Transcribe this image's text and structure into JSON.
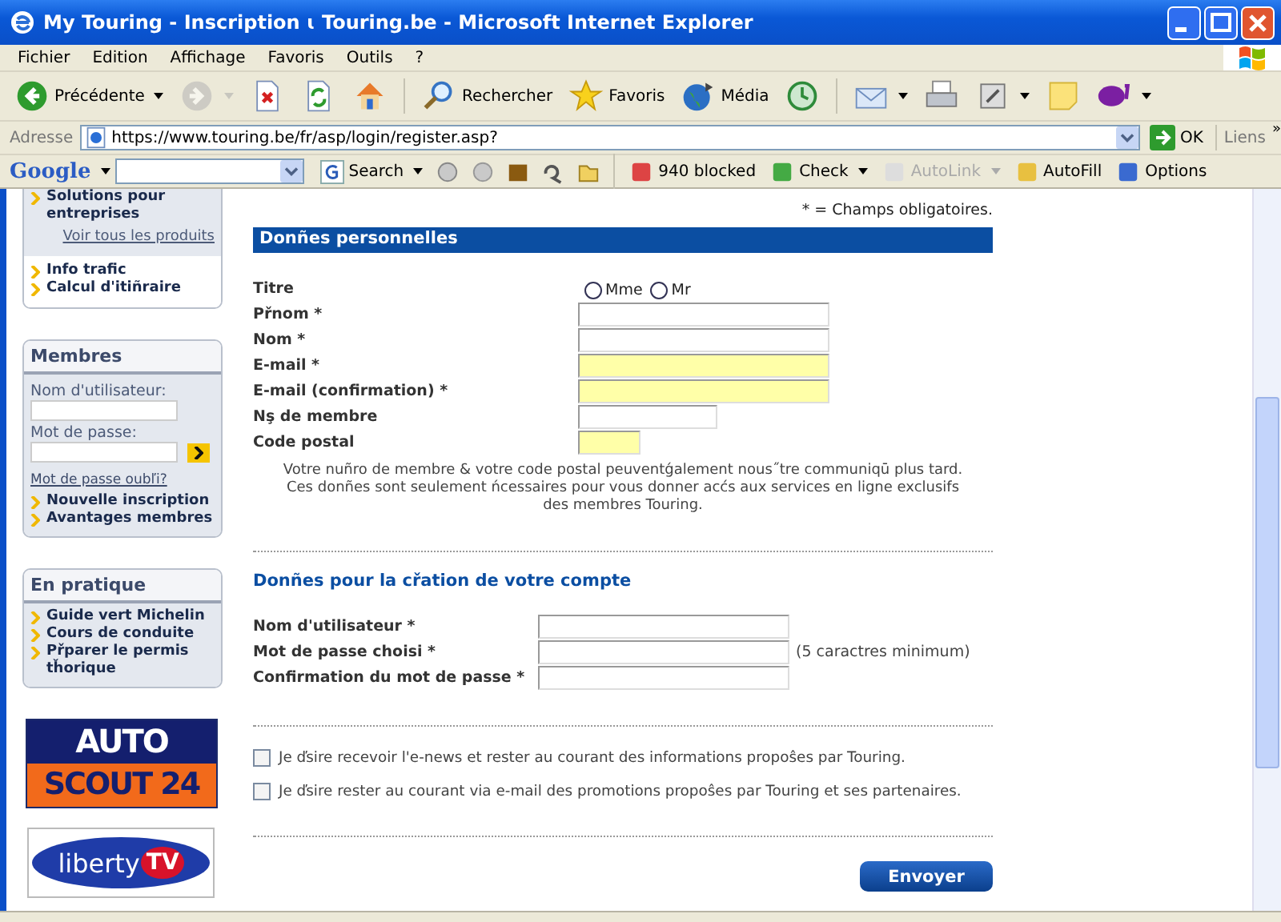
{
  "window": {
    "title": "My Touring - Inscription ɩ Touring.be - Microsoft Internet Explorer"
  },
  "menu": [
    "Fichier",
    "Edition",
    "Affichage",
    "Favoris",
    "Outils",
    "?"
  ],
  "toolbar": [
    {
      "label": "Précédente",
      "dropdown": true,
      "disabled": false
    },
    {
      "dropdown": true,
      "disabled": true
    },
    {
      "dropdown": false,
      "disabled": false
    },
    {
      "dropdown": false,
      "disabled": false
    },
    {
      "dropdown": false,
      "disabled": false
    },
    {
      "label": "Rechercher",
      "dropdown": false,
      "disabled": false,
      "separator_before": true
    },
    {
      "label": "Favoris",
      "dropdown": false,
      "disabled": false
    },
    {
      "label": "Média",
      "dropdown": false,
      "disabled": false
    },
    {
      "dropdown": false,
      "disabled": false
    },
    {
      "dropdown": true,
      "disabled": false,
      "separator_before": true
    },
    {
      "dropdown": false,
      "disabled": false
    },
    {
      "dropdown": true,
      "disabled": false
    },
    {
      "dropdown": false,
      "disabled": false
    },
    {
      "dropdown": true,
      "disabled": false
    }
  ],
  "address": {
    "label": "Adresse",
    "url": "https://www.touring.be/fr/asp/login/register.asp?",
    "go": "OK",
    "links": "Liens",
    "more": "»"
  },
  "google_bar": {
    "logo": "Google",
    "search": "Search",
    "items": [
      {
        "label": "940 blocked",
        "dropdown": false,
        "disabled": false
      },
      {
        "label": "Check",
        "dropdown": true,
        "disabled": false
      },
      {
        "label": "AutoLink",
        "dropdown": true,
        "disabled": true
      },
      {
        "label": "AutoFill",
        "dropdown": false,
        "disabled": false
      },
      {
        "label": "Options",
        "dropdown": false,
        "disabled": false
      }
    ]
  },
  "sidebar": {
    "products": {
      "items": [
        "Solutions pour entreprises"
      ],
      "all_link": "Voir tous les produits",
      "tools": [
        "Info trafic",
        "Calcul d'itiñraire"
      ]
    },
    "members": {
      "title": "Membres",
      "username_label": "Nom d'utilisateur:",
      "password_label": "Mot de passe:",
      "forgot": "Mot de passe oubľi?",
      "links": [
        "Nouvelle inscription",
        "Avantages membres"
      ]
    },
    "practical": {
      "title": "En pratique",
      "links": [
        "Guide vert Michelin",
        "Cours de conduite",
        "Přparer le permis tȟorique"
      ]
    },
    "banners": [
      {
        "kind": "autoscout",
        "lines": [
          "AUTO",
          "SCOUT 24"
        ]
      },
      {
        "kind": "liberty",
        "parts": [
          "liberty",
          "TV"
        ]
      }
    ]
  },
  "form": {
    "required_note": "* =  Champs obligatoires.",
    "personal": {
      "title": "Donñes personnelles",
      "fields": [
        {
          "kind": "radio",
          "label": "Titre",
          "options": [
            {
              "label": "Mme",
              "selected": false
            },
            {
              "label": "Mr",
              "selected": false
            }
          ]
        },
        {
          "kind": "longfield",
          "label": "Přnom *",
          "highlighted": false
        },
        {
          "kind": "longfield",
          "label": "Nom *",
          "highlighted": false
        },
        {
          "kind": "longfield",
          "label": "E-mail *",
          "highlighted": true
        },
        {
          "kind": "longfield",
          "label": "E-mail (confirmation) *",
          "highlighted": true
        },
        {
          "kind": "midfield",
          "label": "Nş de membre",
          "highlighted": false
        },
        {
          "kind": "shortfield",
          "label": "Code postal",
          "highlighted": true
        }
      ]
    },
    "note": "Votre nuñro de membre & votre code postal peuventǵalement nous˝tre communiqū plus tard. Ces donñes sont seulement ńcessaires pour vous donner acćs aux services en ligne exclusifs des membres Touring.",
    "account": {
      "title": "Donñes pour la cřation de votre compte",
      "fields": [
        {
          "label": "Nom d'utilisateur *"
        },
        {
          "label": "Mot de passe choisi *",
          "hint": "(5 caractres minimum)"
        },
        {
          "label": "Confirmation du mot de passe *"
        }
      ]
    },
    "options": [
      {
        "label": "Je ďsire recevoir l'e-news et rester au courant des informations propoŝes par Touring.",
        "checked": false
      },
      {
        "label": "Je ďsire rester au courant via e-mail des promotions propoŝes par Touring et ses partenaires.",
        "checked": false
      }
    ],
    "submit": "Envoyer"
  }
}
